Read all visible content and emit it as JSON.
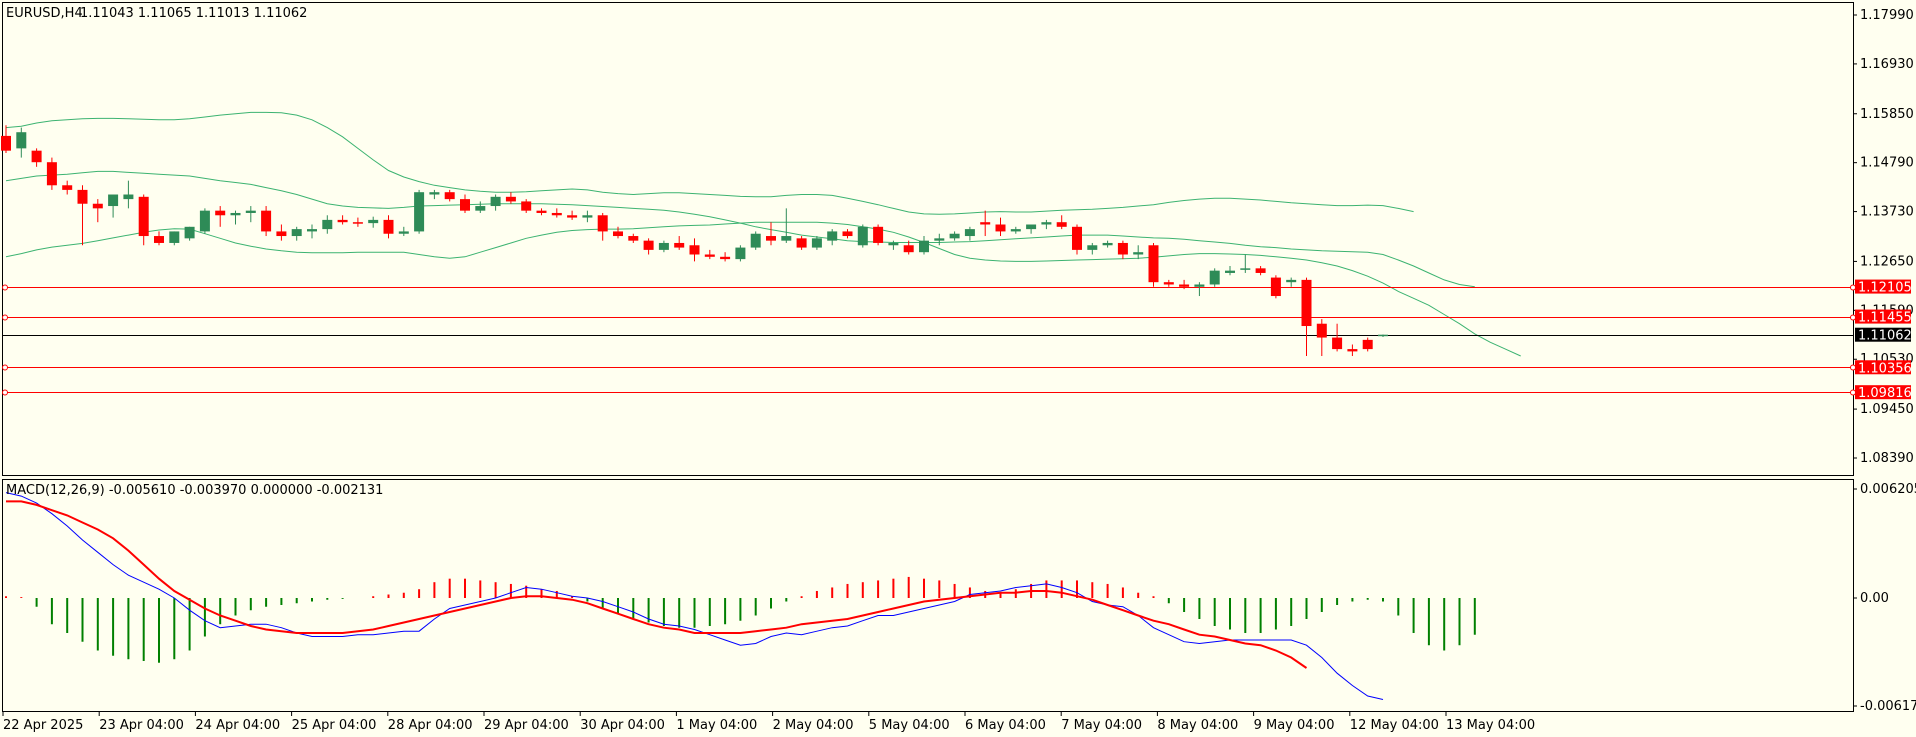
{
  "header": {
    "symbol": "EURUSD,H4",
    "ohlc": "1.11043 1.11065 1.11013 1.11062"
  },
  "macd_header": "MACD(12,26,9) -0.005610 -0.003970 0.000000 -0.002131",
  "colors": {
    "background": "#FFFFF0",
    "bull": "#2E8B57",
    "bear": "#FF0000",
    "bands": "#3CB371",
    "macd_line": "#0000FF",
    "signal_line": "#FF0000",
    "level_line": "#FF0000",
    "price_line": "#000000"
  },
  "chart_data": [
    {
      "type": "candlestick",
      "title": "EURUSD,H4",
      "y_ticks": [
        "1.17990",
        "1.16930",
        "1.15850",
        "1.14790",
        "1.13730",
        "1.12650",
        "1.11590",
        "1.10530",
        "1.09450",
        "1.08390"
      ],
      "ylim": [
        1.0787,
        1.1834
      ],
      "x_ticks": [
        "22 Apr 2025",
        "23 Apr 04:00",
        "24 Apr 04:00",
        "25 Apr 04:00",
        "28 Apr 04:00",
        "29 Apr 04:00",
        "30 Apr 04:00",
        "1 May 04:00",
        "2 May 04:00",
        "5 May 04:00",
        "6 May 04:00",
        "7 May 04:00",
        "8 May 04:00",
        "9 May 04:00",
        "12 May 04:00",
        "13 May 04:00"
      ],
      "candles_note": "open, high, low, close (~H4 bars)",
      "candles": [
        [
          1.1537,
          1.156,
          1.15,
          1.1505
        ],
        [
          1.151,
          1.1555,
          1.149,
          1.1545
        ],
        [
          1.1505,
          1.151,
          1.147,
          1.148
        ],
        [
          1.148,
          1.149,
          1.142,
          1.143
        ],
        [
          1.143,
          1.144,
          1.141,
          1.142
        ],
        [
          1.142,
          1.143,
          1.13,
          1.139
        ],
        [
          1.139,
          1.14,
          1.135,
          1.138
        ],
        [
          1.1385,
          1.141,
          1.136,
          1.141
        ],
        [
          1.14,
          1.144,
          1.138,
          1.141
        ],
        [
          1.1405,
          1.141,
          1.13,
          1.132
        ],
        [
          1.132,
          1.133,
          1.13,
          1.1305
        ],
        [
          1.1305,
          1.133,
          1.13,
          1.133
        ],
        [
          1.1315,
          1.134,
          1.131,
          1.134
        ],
        [
          1.133,
          1.138,
          1.1325,
          1.1375
        ],
        [
          1.1375,
          1.1385,
          1.134,
          1.1365
        ],
        [
          1.1365,
          1.1375,
          1.1345,
          1.137
        ],
        [
          1.137,
          1.1385,
          1.135,
          1.1375
        ],
        [
          1.1375,
          1.1385,
          1.132,
          1.133
        ],
        [
          1.133,
          1.1345,
          1.131,
          1.132
        ],
        [
          1.132,
          1.134,
          1.131,
          1.1335
        ],
        [
          1.133,
          1.1345,
          1.1315,
          1.1335
        ],
        [
          1.1335,
          1.1365,
          1.1325,
          1.1355
        ],
        [
          1.1355,
          1.1365,
          1.1345,
          1.135
        ],
        [
          1.135,
          1.136,
          1.134,
          1.1348
        ],
        [
          1.1348,
          1.1362,
          1.1338,
          1.1355
        ],
        [
          1.1355,
          1.1365,
          1.1315,
          1.1325
        ],
        [
          1.1325,
          1.134,
          1.132,
          1.133
        ],
        [
          1.133,
          1.142,
          1.1325,
          1.1415
        ],
        [
          1.141,
          1.142,
          1.14,
          1.1415
        ],
        [
          1.1415,
          1.142,
          1.1395,
          1.14
        ],
        [
          1.14,
          1.141,
          1.137,
          1.1375
        ],
        [
          1.1375,
          1.1395,
          1.137,
          1.1385
        ],
        [
          1.1385,
          1.141,
          1.1375,
          1.1405
        ],
        [
          1.1405,
          1.1415,
          1.139,
          1.1395
        ],
        [
          1.1395,
          1.14,
          1.137,
          1.1375
        ],
        [
          1.1375,
          1.138,
          1.1365,
          1.137
        ],
        [
          1.137,
          1.138,
          1.136,
          1.1365
        ],
        [
          1.1365,
          1.1375,
          1.1355,
          1.136
        ],
        [
          1.136,
          1.1375,
          1.135,
          1.1365
        ],
        [
          1.1365,
          1.137,
          1.131,
          1.133
        ],
        [
          1.133,
          1.134,
          1.1315,
          1.132
        ],
        [
          1.132,
          1.1325,
          1.1305,
          1.131
        ],
        [
          1.131,
          1.1315,
          1.128,
          1.129
        ],
        [
          1.129,
          1.131,
          1.1285,
          1.1305
        ],
        [
          1.1305,
          1.132,
          1.129,
          1.1295
        ],
        [
          1.13,
          1.1315,
          1.1265,
          1.128
        ],
        [
          1.128,
          1.129,
          1.127,
          1.1275
        ],
        [
          1.1275,
          1.1285,
          1.1265,
          1.127
        ],
        [
          1.127,
          1.13,
          1.1265,
          1.1295
        ],
        [
          1.1295,
          1.133,
          1.129,
          1.1325
        ],
        [
          1.132,
          1.135,
          1.13,
          1.131
        ],
        [
          1.131,
          1.138,
          1.1305,
          1.132
        ],
        [
          1.1315,
          1.132,
          1.129,
          1.1295
        ],
        [
          1.1295,
          1.132,
          1.129,
          1.1315
        ],
        [
          1.131,
          1.1335,
          1.13,
          1.133
        ],
        [
          1.133,
          1.1335,
          1.1315,
          1.132
        ],
        [
          1.13,
          1.1345,
          1.1295,
          1.134
        ],
        [
          1.134,
          1.1345,
          1.13,
          1.1305
        ],
        [
          1.13,
          1.131,
          1.129,
          1.1305
        ],
        [
          1.13,
          1.131,
          1.128,
          1.1285
        ],
        [
          1.1285,
          1.132,
          1.128,
          1.131
        ],
        [
          1.131,
          1.1325,
          1.13,
          1.1315
        ],
        [
          1.1315,
          1.133,
          1.131,
          1.1325
        ],
        [
          1.132,
          1.134,
          1.131,
          1.1335
        ],
        [
          1.135,
          1.1375,
          1.132,
          1.1345
        ],
        [
          1.1345,
          1.136,
          1.132,
          1.133
        ],
        [
          1.133,
          1.134,
          1.1325,
          1.1335
        ],
        [
          1.1335,
          1.1345,
          1.1325,
          1.1345
        ],
        [
          1.1345,
          1.1355,
          1.1335,
          1.135
        ],
        [
          1.135,
          1.1365,
          1.1335,
          1.134
        ],
        [
          1.134,
          1.1345,
          1.128,
          1.129
        ],
        [
          1.129,
          1.1305,
          1.128,
          1.13
        ],
        [
          1.13,
          1.131,
          1.1295,
          1.1305
        ],
        [
          1.1305,
          1.131,
          1.127,
          1.128
        ],
        [
          1.128,
          1.13,
          1.127,
          1.1285
        ],
        [
          1.13,
          1.1305,
          1.121,
          1.122
        ],
        [
          1.122,
          1.1225,
          1.121,
          1.1215
        ],
        [
          1.1215,
          1.1225,
          1.1205,
          1.121
        ],
        [
          1.121,
          1.122,
          1.119,
          1.1215
        ],
        [
          1.1215,
          1.125,
          1.121,
          1.1245
        ],
        [
          1.124,
          1.1255,
          1.1235,
          1.1245
        ],
        [
          1.125,
          1.128,
          1.124,
          1.125
        ],
        [
          1.125,
          1.1255,
          1.1235,
          1.124
        ],
        [
          1.123,
          1.1235,
          1.1185,
          1.119
        ],
        [
          1.122,
          1.123,
          1.121,
          1.1225
        ],
        [
          1.1225,
          1.123,
          1.106,
          1.1125
        ],
        [
          1.113,
          1.114,
          1.106,
          1.11
        ],
        [
          1.11,
          1.113,
          1.107,
          1.1075
        ],
        [
          1.1075,
          1.1085,
          1.106,
          1.107
        ],
        [
          1.1095,
          1.11,
          1.107,
          1.1075
        ],
        [
          1.11043,
          1.11065,
          1.11013,
          1.11062
        ]
      ],
      "bollinger": {
        "upper": [
          1.1555,
          1.1558,
          1.1565,
          1.157,
          1.1572,
          1.1574,
          1.1575,
          1.1575,
          1.1574,
          1.1573,
          1.1572,
          1.1572,
          1.1574,
          1.1578,
          1.1582,
          1.1585,
          1.1588,
          1.1588,
          1.1587,
          1.1582,
          1.1572,
          1.1555,
          1.1535,
          1.151,
          1.1485,
          1.1462,
          1.1448,
          1.1438,
          1.143,
          1.1425,
          1.142,
          1.1417,
          1.1415,
          1.1415,
          1.1416,
          1.1418,
          1.142,
          1.1422,
          1.142,
          1.1415,
          1.1412,
          1.141,
          1.1412,
          1.1414,
          1.1414,
          1.1412,
          1.141,
          1.1408,
          1.1406,
          1.1405,
          1.1405,
          1.1408,
          1.141,
          1.141,
          1.1408,
          1.1402,
          1.1395,
          1.1388,
          1.138,
          1.1372,
          1.1368,
          1.1367,
          1.1368,
          1.137,
          1.1372,
          1.1373,
          1.1372,
          1.1372,
          1.1374,
          1.1376,
          1.1377,
          1.1378,
          1.138,
          1.1382,
          1.1385,
          1.1388,
          1.1393,
          1.1397,
          1.14,
          1.1402,
          1.1402,
          1.14,
          1.1398,
          1.1395,
          1.1392,
          1.139,
          1.1388,
          1.1386,
          1.1386,
          1.1387,
          1.1386,
          1.138,
          1.1373
        ],
        "mid": [
          1.144,
          1.1445,
          1.145,
          1.1452,
          1.1454,
          1.1457,
          1.146,
          1.146,
          1.1458,
          1.1456,
          1.1454,
          1.1452,
          1.145,
          1.1445,
          1.144,
          1.1436,
          1.1432,
          1.1425,
          1.1418,
          1.141,
          1.14,
          1.139,
          1.1385,
          1.1382,
          1.1381,
          1.138,
          1.1382,
          1.1385,
          1.1386,
          1.1387,
          1.1388,
          1.1389,
          1.139,
          1.139,
          1.139,
          1.139,
          1.1389,
          1.1388,
          1.1386,
          1.1384,
          1.1382,
          1.138,
          1.1378,
          1.1376,
          1.1372,
          1.1367,
          1.1362,
          1.1355,
          1.1348,
          1.134,
          1.1334,
          1.1328,
          1.1322,
          1.1318,
          1.1314,
          1.131,
          1.1308,
          1.1307,
          1.1306,
          1.1306,
          1.1306,
          1.1306,
          1.1307,
          1.1308,
          1.131,
          1.1312,
          1.1314,
          1.1316,
          1.1318,
          1.132,
          1.1322,
          1.1322,
          1.1322,
          1.132,
          1.1318,
          1.1316,
          1.1315,
          1.1313,
          1.131,
          1.1307,
          1.1304,
          1.13,
          1.1297,
          1.1295,
          1.1292,
          1.129,
          1.1288,
          1.1287,
          1.1286,
          1.1285,
          1.128,
          1.1268,
          1.1255,
          1.124,
          1.1225,
          1.1215,
          1.121
        ],
        "lower": [
          1.1275,
          1.1282,
          1.129,
          1.1296,
          1.13,
          1.1304,
          1.131,
          1.1316,
          1.1322,
          1.1328,
          1.1333,
          1.1336,
          1.1335,
          1.1325,
          1.1315,
          1.1305,
          1.1298,
          1.1292,
          1.1288,
          1.1285,
          1.1284,
          1.1284,
          1.1284,
          1.1285,
          1.1285,
          1.1285,
          1.1285,
          1.128,
          1.1275,
          1.1272,
          1.1275,
          1.1285,
          1.1295,
          1.1305,
          1.1315,
          1.1322,
          1.1328,
          1.1332,
          1.1334,
          1.1335,
          1.1335,
          1.1336,
          1.1338,
          1.134,
          1.1342,
          1.1343,
          1.1344,
          1.1346,
          1.1348,
          1.135,
          1.135,
          1.135,
          1.135,
          1.135,
          1.1348,
          1.1345,
          1.134,
          1.1335,
          1.1328,
          1.1318,
          1.1306,
          1.1293,
          1.128,
          1.1272,
          1.1268,
          1.1266,
          1.1265,
          1.1265,
          1.1266,
          1.1267,
          1.1268,
          1.1269,
          1.127,
          1.1271,
          1.1272,
          1.1274,
          1.1277,
          1.128,
          1.1282,
          1.1282,
          1.1281,
          1.128,
          1.1278,
          1.1275,
          1.1272,
          1.1268,
          1.1262,
          1.1255,
          1.1245,
          1.1233,
          1.1218,
          1.12,
          1.1185,
          1.117,
          1.115,
          1.113,
          1.1108,
          1.109,
          1.1075,
          1.106
        ]
      },
      "levels": [
        {
          "label": "1.12105",
          "value": 1.12105
        },
        {
          "label": "1.11455",
          "value": 1.11455
        },
        {
          "label": "1.10356",
          "value": 1.10356
        },
        {
          "label": "1.09816",
          "value": 1.09816
        }
      ],
      "current_price": {
        "label": "1.11062",
        "value": 1.11062
      }
    },
    {
      "type": "macd",
      "title": "MACD(12,26,9) -0.005610 -0.003970 0.000000 -0.002131",
      "y_ticks": [
        "0.006205",
        "0.00",
        "-0.006173"
      ],
      "ylim": [
        -0.006173,
        0.006205
      ],
      "histogram": [
        0.0001,
        5e-05,
        -0.0005,
        -0.0015,
        -0.002,
        -0.0025,
        -0.003,
        -0.0033,
        -0.0035,
        -0.0036,
        -0.0037,
        -0.0035,
        -0.003,
        -0.0022,
        -0.0015,
        -0.001,
        -0.0007,
        -0.0005,
        -0.0004,
        -0.0003,
        -0.0002,
        -0.0001,
        -5e-05,
        0.0,
        0.0001,
        0.0002,
        0.0003,
        0.0005,
        0.0009,
        0.0011,
        0.0011,
        0.001,
        0.0009,
        0.0008,
        0.0007,
        0.0005,
        0.0004,
        0.0001,
        -0.0002,
        -0.0006,
        -0.0009,
        -0.0012,
        -0.0014,
        -0.0016,
        -0.0017,
        -0.0017,
        -0.0016,
        -0.0015,
        -0.0013,
        -0.001,
        -0.0006,
        -0.0002,
        0.0001,
        0.0004,
        0.0006,
        0.0008,
        0.0009,
        0.001,
        0.0011,
        0.0012,
        0.0011,
        0.001,
        0.0008,
        0.0006,
        0.0004,
        0.0003,
        0.0005,
        0.0008,
        0.001,
        0.001,
        0.001,
        0.0009,
        0.0008,
        0.0006,
        0.0003,
        0.0001,
        -0.0003,
        -0.0008,
        -0.0012,
        -0.0016,
        -0.0018,
        -0.002,
        -0.002,
        -0.0018,
        -0.0016,
        -0.0012,
        -0.0008,
        -0.0004,
        -0.0002,
        -0.0001,
        -0.0002,
        -0.001,
        -0.002,
        -0.0027,
        -0.003,
        -0.0027,
        -0.0021
      ],
      "macd_line": [
        0.006,
        0.0058,
        0.0054,
        0.0048,
        0.0041,
        0.0033,
        0.0026,
        0.0019,
        0.0013,
        0.0009,
        0.0005,
        0.0,
        -0.0007,
        -0.0013,
        -0.0017,
        -0.0016,
        -0.0015,
        -0.0015,
        -0.0017,
        -0.002,
        -0.0022,
        -0.0022,
        -0.0022,
        -0.0021,
        -0.0021,
        -0.002,
        -0.0019,
        -0.0019,
        -0.0012,
        -0.0006,
        -0.0004,
        -0.0002,
        0.0,
        0.0003,
        0.0006,
        0.0005,
        0.0003,
        0.0001,
        0.0,
        -0.0002,
        -0.0005,
        -0.0008,
        -0.0012,
        -0.0015,
        -0.0016,
        -0.0018,
        -0.0021,
        -0.0024,
        -0.0027,
        -0.0026,
        -0.0022,
        -0.002,
        -0.0021,
        -0.0019,
        -0.0017,
        -0.0016,
        -0.0013,
        -0.001,
        -0.001,
        -0.0008,
        -0.0006,
        -0.0004,
        -0.0002,
        0.0002,
        0.0003,
        0.0004,
        0.0006,
        0.0007,
        0.0008,
        0.0006,
        0.0003,
        -0.0002,
        -0.0004,
        -0.0005,
        -0.001,
        -0.0017,
        -0.0021,
        -0.0025,
        -0.0026,
        -0.0025,
        -0.0024,
        -0.0024,
        -0.0024,
        -0.0024,
        -0.0024,
        -0.0027,
        -0.0034,
        -0.0043,
        -0.005,
        -0.0056,
        -0.0058
      ],
      "signal_line": [
        0.0055,
        0.0055,
        0.0053,
        0.005,
        0.0047,
        0.0043,
        0.0039,
        0.0034,
        0.0027,
        0.0019,
        0.0011,
        0.0004,
        -0.0001,
        -0.0006,
        -0.001,
        -0.0013,
        -0.0016,
        -0.0018,
        -0.0019,
        -0.002,
        -0.002,
        -0.002,
        -0.002,
        -0.0019,
        -0.0018,
        -0.0016,
        -0.0014,
        -0.0012,
        -0.001,
        -0.0008,
        -0.0006,
        -0.0004,
        -0.0002,
        0.0,
        0.0001,
        0.0001,
        0.0,
        -0.0001,
        -0.0003,
        -0.0006,
        -0.0009,
        -0.0012,
        -0.0015,
        -0.0017,
        -0.0018,
        -0.002,
        -0.002,
        -0.002,
        -0.002,
        -0.0019,
        -0.0018,
        -0.0017,
        -0.0015,
        -0.0014,
        -0.0013,
        -0.0012,
        -0.001,
        -0.0008,
        -0.0006,
        -0.0004,
        -0.0002,
        -0.0001,
        0.0,
        0.0001,
        0.0002,
        0.0003,
        0.0003,
        0.0004,
        0.0004,
        0.0003,
        0.0001,
        -0.0001,
        -0.0004,
        -0.0007,
        -0.001,
        -0.0013,
        -0.0015,
        -0.0018,
        -0.0021,
        -0.0022,
        -0.0024,
        -0.0026,
        -0.0027,
        -0.003,
        -0.0034,
        -0.004
      ]
    }
  ]
}
